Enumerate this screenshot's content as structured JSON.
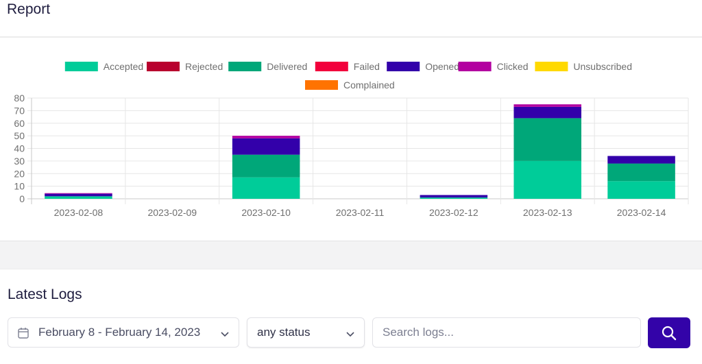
{
  "header": {
    "title": "Report"
  },
  "chart_data": {
    "type": "bar",
    "stacked": true,
    "title": "",
    "xlabel": "",
    "ylabel": "",
    "ylim": [
      0,
      80
    ],
    "yticks": [
      0,
      10,
      20,
      30,
      40,
      50,
      60,
      70,
      80
    ],
    "grid": true,
    "legend_position": "top-center",
    "categories": [
      "2023-02-08",
      "2023-02-09",
      "2023-02-10",
      "2023-02-11",
      "2023-02-12",
      "2023-02-13",
      "2023-02-14"
    ],
    "series": [
      {
        "name": "Accepted",
        "color": "#00cc99",
        "values": [
          2,
          0,
          17,
          0,
          1,
          30,
          14
        ]
      },
      {
        "name": "Rejected",
        "color": "#b8002e",
        "values": [
          0,
          0,
          0,
          0,
          0,
          0,
          0
        ]
      },
      {
        "name": "Delivered",
        "color": "#00a779",
        "values": [
          0,
          0,
          18,
          0,
          0,
          34,
          14
        ]
      },
      {
        "name": "Failed",
        "color": "#f2003c",
        "values": [
          0,
          0,
          0,
          0,
          0,
          0,
          0
        ]
      },
      {
        "name": "Opened",
        "color": "#3300aa",
        "values": [
          2,
          0,
          13,
          0,
          2,
          9,
          6
        ]
      },
      {
        "name": "Clicked",
        "color": "#b300a0",
        "values": [
          0.5,
          0,
          2,
          0,
          0,
          2,
          0
        ]
      },
      {
        "name": "Unsubscribed",
        "color": "#ffd900",
        "values": [
          0,
          0,
          0,
          0,
          0,
          0,
          0
        ]
      },
      {
        "name": "Complained",
        "color": "#ff7300",
        "values": [
          0,
          0,
          0,
          0,
          0,
          0,
          0
        ]
      }
    ]
  },
  "logs": {
    "title": "Latest Logs",
    "date_range": "February 8 - February 14, 2023",
    "status_select": "any status",
    "search_placeholder": "Search logs...",
    "search_button_icon": "search-icon",
    "accent_color": "#3303a8"
  }
}
